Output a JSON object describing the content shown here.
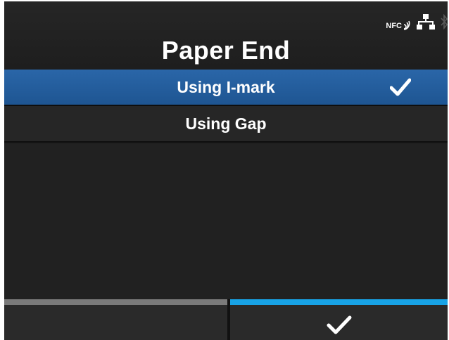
{
  "header": {
    "title": "Paper End",
    "status": {
      "nfc_label": "NFC",
      "icons": [
        "nfc-icon",
        "network-icon",
        "bluetooth-icon"
      ]
    }
  },
  "options": [
    {
      "label": "Using I-mark",
      "selected": true
    },
    {
      "label": "Using Gap",
      "selected": false
    }
  ],
  "softkeys": {
    "left": {
      "label": "",
      "color": "#7a7a7a"
    },
    "right": {
      "icon": "checkmark-icon",
      "color": "#18a3e6"
    }
  },
  "colors": {
    "selection": "#2a66a8",
    "accent": "#18a3e6",
    "background": "#1f1f1f"
  }
}
